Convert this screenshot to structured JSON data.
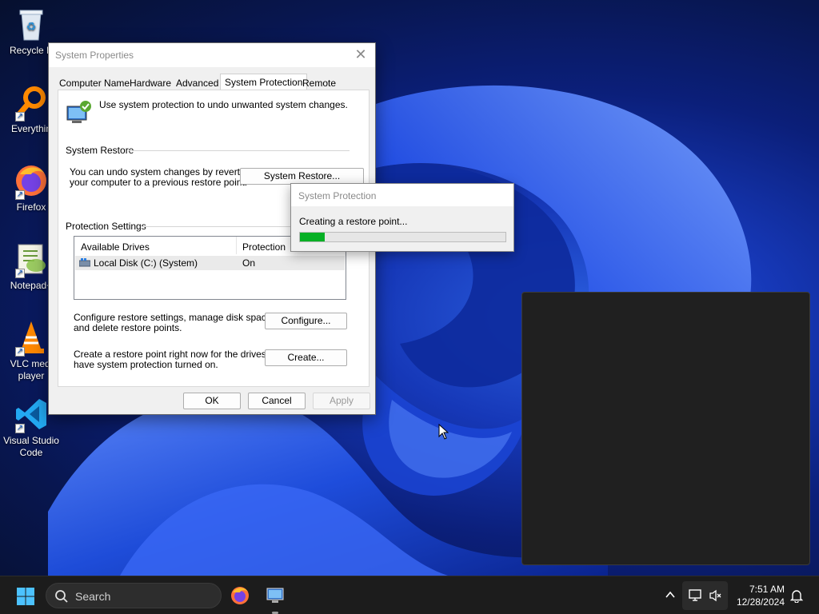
{
  "desktop": {
    "icons": [
      {
        "label": "Recycle B",
        "icon": "recycle-bin-icon"
      },
      {
        "label": "Everythin",
        "icon": "everything-search-icon"
      },
      {
        "label": "Firefox",
        "icon": "firefox-icon"
      },
      {
        "label": "Notepad+",
        "icon": "notepad-plus-plus-icon"
      },
      {
        "label": "VLC medi\nplayer",
        "line1": "VLC medi",
        "line2": "player",
        "icon": "vlc-icon"
      },
      {
        "label": "Visual Studio Code",
        "line1": "Visual Studio",
        "line2": "Code",
        "icon": "vscode-icon"
      }
    ]
  },
  "system_properties": {
    "title": "System Properties",
    "tabs": [
      {
        "label": "Computer Name"
      },
      {
        "label": "Hardware"
      },
      {
        "label": "Advanced"
      },
      {
        "label": "System Protection",
        "active": true
      },
      {
        "label": "Remote"
      }
    ],
    "intro_text": "Use system protection to undo unwanted system changes.",
    "system_restore": {
      "group_label": "System Restore",
      "description_line1": "You can undo system changes by reverting",
      "description_line2": "your computer to a previous restore point.",
      "button_label": "System Restore..."
    },
    "protection_settings": {
      "group_label": "Protection Settings",
      "columns": [
        "Available Drives",
        "Protection"
      ],
      "rows": [
        {
          "drive": "Local Disk (C:) (System)",
          "protection": "On"
        }
      ],
      "configure_text_line1": "Configure restore settings, manage disk space,",
      "configure_text_line2": "and delete restore points.",
      "configure_button": "Configure...",
      "create_text_line1": "Create a restore point right now for the drives that",
      "create_text_line2": "have system protection turned on.",
      "create_button": "Create..."
    },
    "buttons": {
      "ok": "OK",
      "cancel": "Cancel",
      "apply": "Apply"
    }
  },
  "progress_dialog": {
    "title": "System Protection",
    "message": "Creating a restore point...",
    "progress_fraction": 0.12,
    "bar_color": "#06b025"
  },
  "taskbar": {
    "search_label": "Search",
    "pinned": [
      "firefox-icon",
      "system-properties-icon"
    ],
    "time": "7:51 AM",
    "date": "12/28/2024"
  }
}
